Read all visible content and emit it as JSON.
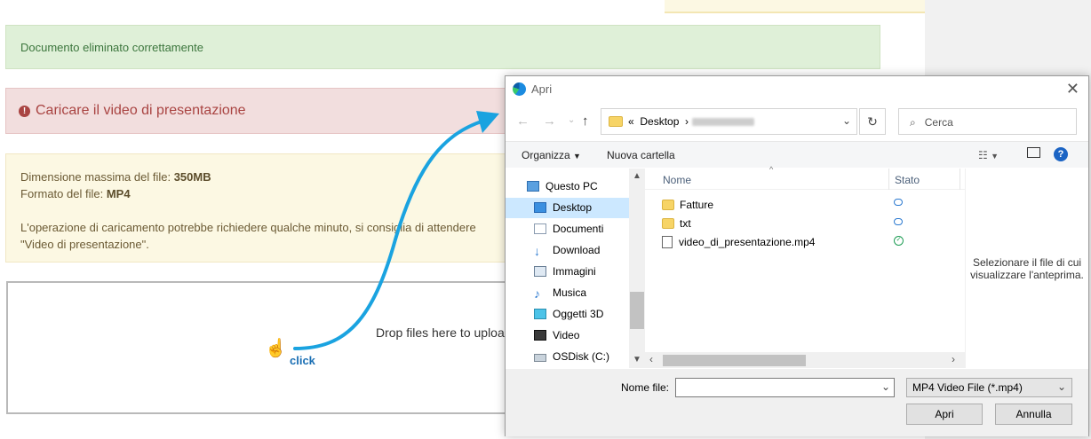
{
  "page": {
    "success_message": "Documento eliminato correttamente",
    "error_message": "Caricare il video di presentazione",
    "warning": {
      "max_size_label": "Dimensione massima del file: ",
      "max_size_value": "350MB",
      "format_label": "Formato del file: ",
      "format_value": "MP4",
      "note_line1": "L'operazione di caricamento potrebbe richiedere qualche minuto, si consiglia di attendere",
      "note_line2": "\"Video di presentazione\"."
    },
    "dropzone_text": "Drop files here to upload",
    "annotation": "click"
  },
  "dialog": {
    "title": "Apri",
    "breadcrumb_prefix": "«",
    "breadcrumb": [
      "Desktop"
    ],
    "search_placeholder": "Cerca",
    "toolbar": {
      "organize": "Organizza",
      "new_folder": "Nuova cartella"
    },
    "nav_items": [
      {
        "label": "Questo PC",
        "icon": "pc-icon"
      },
      {
        "label": "Desktop",
        "icon": "desktop-icon",
        "selected": true
      },
      {
        "label": "Documenti",
        "icon": "documents-icon"
      },
      {
        "label": "Download",
        "icon": "download-icon"
      },
      {
        "label": "Immagini",
        "icon": "pictures-icon"
      },
      {
        "label": "Musica",
        "icon": "music-icon"
      },
      {
        "label": "Oggetti 3D",
        "icon": "3d-objects-icon"
      },
      {
        "label": "Video",
        "icon": "video-icon"
      },
      {
        "label": "OSDisk (C:)",
        "icon": "disk-icon"
      }
    ],
    "columns": {
      "name": "Nome",
      "status": "Stato"
    },
    "files": [
      {
        "name": "Fatture",
        "type": "folder",
        "status": "cloud-icon"
      },
      {
        "name": "txt",
        "type": "folder",
        "status": "cloud-icon"
      },
      {
        "name": "video_di_presentazione.mp4",
        "type": "file",
        "status": "synced-check-icon"
      }
    ],
    "preview_text": "Selezionare il file di cui visualizzare l'anteprima.",
    "filename_label": "Nome file:",
    "filename_value": "",
    "file_type": "MP4 Video File (*.mp4)",
    "open_button": "Apri",
    "cancel_button": "Annulla"
  },
  "colors": {
    "success_bg": "#dff0d8",
    "danger_bg": "#f2dede",
    "warning_bg": "#fcf8e3",
    "arrow": "#1aa3e0",
    "selection": "#cce8ff"
  }
}
